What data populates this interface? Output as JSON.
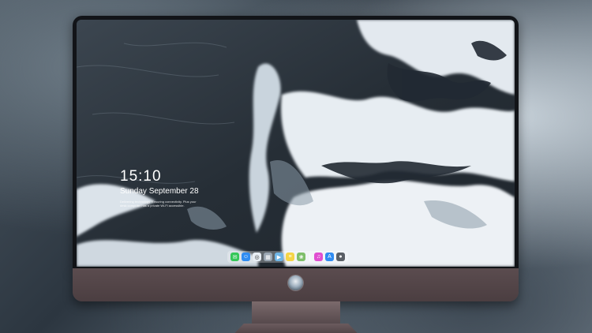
{
  "lock_screen": {
    "time": "15:10",
    "date": "Sunday September 28",
    "tagline": "Delivering technology. Ensuring connectivity. Plus your desk computer has a private Wi-Fi accessible."
  },
  "dock": {
    "apps": [
      {
        "name": "messages-icon",
        "color": "#35c759",
        "glyph": "✉"
      },
      {
        "name": "finder-icon",
        "color": "#2f8cf2",
        "glyph": "☺"
      },
      {
        "name": "safari-icon",
        "color": "#e8eef4",
        "glyph": "◎"
      },
      {
        "name": "launchpad-icon",
        "color": "#9aa6b2",
        "glyph": "▦"
      },
      {
        "name": "final-cut-icon",
        "color": "#6fb6e6",
        "glyph": "▶"
      },
      {
        "name": "notes-icon",
        "color": "#f5d547",
        "glyph": "≡"
      },
      {
        "name": "photos-icon",
        "color": "#7fbf6b",
        "glyph": "❀"
      },
      {
        "name": "itunes-icon",
        "color": "#e04fd0",
        "glyph": "♫"
      },
      {
        "name": "app-store-icon",
        "color": "#2f8cf2",
        "glyph": "A"
      },
      {
        "name": "camera-icon",
        "color": "#5a5f66",
        "glyph": "●"
      }
    ]
  },
  "colors": {
    "bezel": "#121418",
    "chin": "#5b4c4f",
    "stand": "#6b5b5e"
  }
}
